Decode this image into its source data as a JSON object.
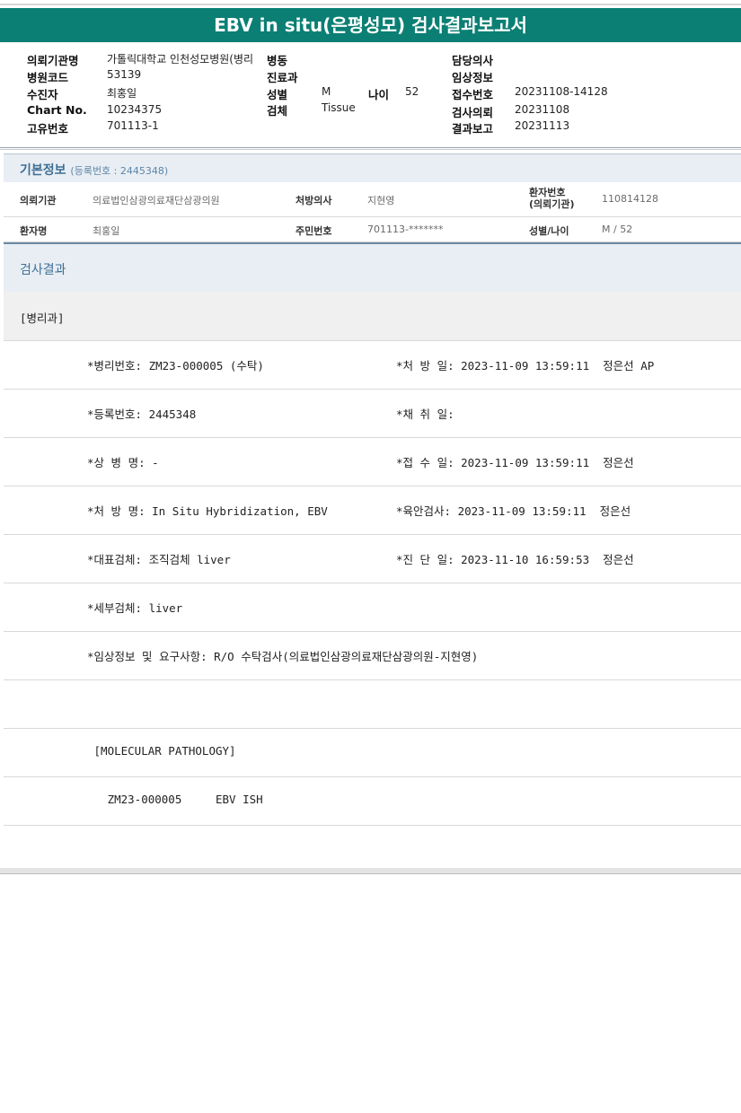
{
  "title": "EBV in situ(은평성모) 검사결과보고서",
  "header": {
    "institution_label": "의뢰기관명",
    "institution_value": "가톨릭대학교 인천성모병원(병리",
    "ward_label": "병동",
    "doctor_label": "담당의사",
    "hospital_code_label": "병원코드",
    "hospital_code_value": "53139",
    "dept_label": "진료과",
    "clinical_label": "임상정보",
    "patient_label": "수진자",
    "patient_value": "최홍일",
    "sex_label": "성별",
    "sex_value": "M",
    "age_label": "나이",
    "age_value": "52",
    "receipt_label": "접수번호",
    "receipt_value": "20231108-14128",
    "chart_label": "Chart No.",
    "chart_value": "10234375",
    "specimen_label": "검체",
    "specimen_value": "Tissue",
    "request_label": "검사의뢰",
    "request_value": "20231108",
    "unique_label": "고유번호",
    "unique_value": "701113-1",
    "report_label": "결과보고",
    "report_value": "20231113"
  },
  "basic_info": {
    "title": "기본정보",
    "subtitle": "(등록번호 : 2445348)",
    "rows": [
      [
        {
          "label": "의뢰기관",
          "value": "의료법인삼광의료재단삼광의원"
        },
        {
          "label": "처방의사",
          "value": "지현영"
        },
        {
          "label": "환자번호\n(의뢰기관)",
          "value": "110814128"
        }
      ],
      [
        {
          "label": "환자명",
          "value": "최홍일"
        },
        {
          "label": "주민번호",
          "value": "701113-*******"
        },
        {
          "label": "성별/나이",
          "value": "M / 52"
        }
      ]
    ]
  },
  "results": {
    "title": "검사결과",
    "department": "[병리과]",
    "rows": [
      {
        "left": "*병리번호: ZM23-000005 (수탁)",
        "right": "*처 방 일: 2023-11-09 13:59:11  정은선 AP"
      },
      {
        "left": "*등록번호: 2445348",
        "right": "*채 취 일:"
      },
      {
        "left": "*상 병 명: -",
        "right": "*접 수 일: 2023-11-09 13:59:11  정은선"
      },
      {
        "left": "*처 방 명: In Situ Hybridization, EBV",
        "right": "*육안검사: 2023-11-09 13:59:11  정은선"
      },
      {
        "left": "*대표검체: 조직검체 liver",
        "right": "*진 단 일: 2023-11-10 16:59:53  정은선"
      },
      {
        "left": "*세부검체: liver",
        "right": ""
      },
      {
        "left": "*임상정보 및 요구사항: R/O 수탁검사(의료법인삼광의료재단삼광의원-지현영)",
        "right": ""
      },
      {
        "left": "",
        "right": ""
      },
      {
        "left": " [MOLECULAR PATHOLOGY]",
        "right": ""
      },
      {
        "left": "   ZM23-000005     EBV ISH",
        "right": ""
      },
      {
        "left": "",
        "right": ""
      }
    ]
  }
}
